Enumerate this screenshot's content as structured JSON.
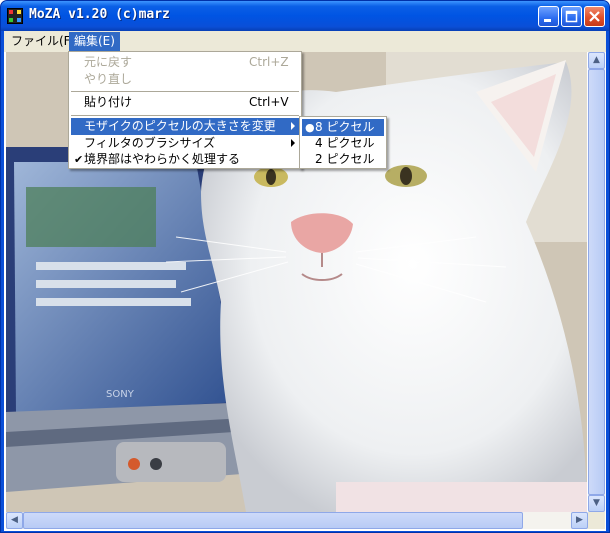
{
  "window": {
    "title": "MoZA v1.20 (c)marz"
  },
  "menubar": {
    "items": [
      {
        "label": "ファイル(F)"
      },
      {
        "label": "編集(E)"
      }
    ]
  },
  "edit_menu": {
    "items": [
      {
        "label": "元に戻す",
        "shortcut": "Ctrl+Z",
        "enabled": false
      },
      {
        "label": "やり直し",
        "shortcut": "",
        "enabled": false
      },
      {
        "label": "貼り付け",
        "shortcut": "Ctrl+V",
        "enabled": true
      },
      {
        "label": "モザイクのピクセルの大きさを変更",
        "submenu": true,
        "highlighted": true
      },
      {
        "label": "フィルタのブラシサイズ",
        "submenu": true
      },
      {
        "label": "境界部はやわらかく処理する",
        "checked": true
      }
    ]
  },
  "pixel_size_submenu": {
    "items": [
      {
        "label": "8 ピクセル",
        "selected": true
      },
      {
        "label": "4 ピクセル",
        "selected": false
      },
      {
        "label": "2 ピクセル",
        "selected": false
      }
    ]
  },
  "image": {
    "laptop_brand": "SONY"
  },
  "icons": {
    "minimize": "minimize-icon",
    "maximize": "maximize-icon",
    "close": "close-icon",
    "check": "✔",
    "radio": "●"
  },
  "colors": {
    "titlebar": "#0054e3",
    "menu_highlight": "#316ac5",
    "menubar_bg": "#ece9d8",
    "disabled_text": "#aca899"
  }
}
